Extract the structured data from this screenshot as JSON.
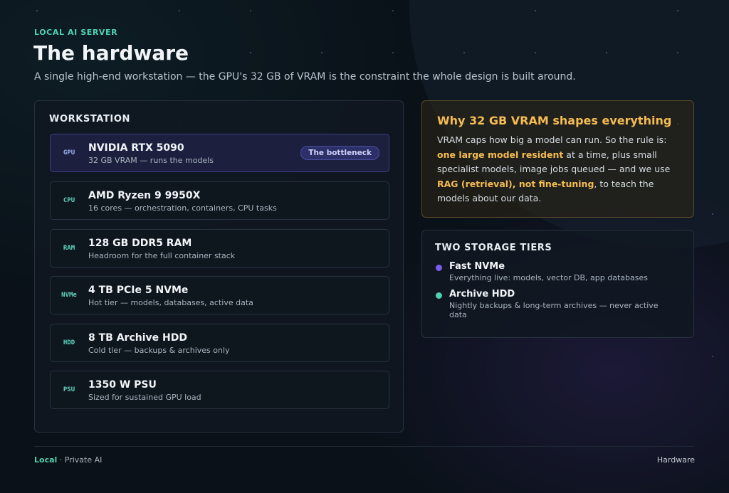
{
  "header": {
    "eyebrow": "LOCAL AI SERVER",
    "title": "The hardware",
    "subtitle": "A single high-end workstation — the GPU's 32 GB of VRAM is the constraint the whole design is built around."
  },
  "workstation": {
    "title": "WORKSTATION",
    "items": [
      {
        "tag": "GPU",
        "name": "NVIDIA RTX 5090",
        "desc": "32 GB VRAM — runs the models",
        "badge": "The bottleneck"
      },
      {
        "tag": "CPU",
        "name": "AMD Ryzen 9 9950X",
        "desc": "16 cores — orchestration, containers, CPU tasks"
      },
      {
        "tag": "RAM",
        "name": "128 GB DDR5 RAM",
        "desc": "Headroom for the full container stack"
      },
      {
        "tag": "NVMe",
        "name": "4 TB PCIe 5 NVMe",
        "desc": "Hot tier — models, databases, active data"
      },
      {
        "tag": "HDD",
        "name": "8 TB Archive HDD",
        "desc": "Cold tier — backups & archives only"
      },
      {
        "tag": "PSU",
        "name": "1350 W PSU",
        "desc": "Sized for sustained GPU load"
      }
    ]
  },
  "vram": {
    "title": "Why 32 GB VRAM shapes everything",
    "p1": "VRAM caps how big a model can run. So the rule is: ",
    "h1": "one large model resident",
    "p2": " at a time, plus small specialist models, image jobs queued — and we use ",
    "h2": "RAG (retrieval), not fine-tuning",
    "p3": ", to teach the models about our data."
  },
  "storage": {
    "title": "TWO STORAGE TIERS",
    "tiers": [
      {
        "name": "Fast NVMe",
        "desc": "Everything live: models, vector DB, app databases",
        "color": "#7a5cf0"
      },
      {
        "name": "Archive HDD",
        "desc": "Nightly backups & long-term archives — never active data",
        "color": "#4fd1b0"
      }
    ]
  },
  "footer": {
    "brand": "Local",
    "left": " · Private AI",
    "right": "Hardware"
  },
  "colors": {
    "accent_teal": "#4fd1b0",
    "accent_gold": "#f5bc52",
    "accent_purple": "#7a5cf0"
  }
}
